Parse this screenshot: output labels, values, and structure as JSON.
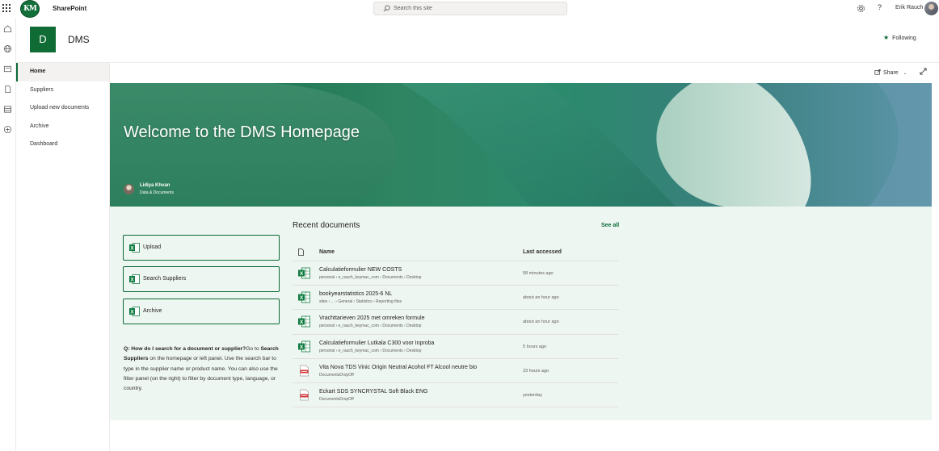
{
  "suite": {
    "app_name": "SharePoint",
    "logo_text": "KM",
    "search_placeholder": "Search this site",
    "help_label": "?",
    "user_name": "Erik Rauch"
  },
  "site": {
    "logo_letter": "D",
    "title": "DMS",
    "following_label": "Following"
  },
  "nav": {
    "items": [
      {
        "label": "Home"
      },
      {
        "label": "Suppliers"
      },
      {
        "label": "Upload new documents"
      },
      {
        "label": "Archive"
      },
      {
        "label": "Dashboard"
      }
    ]
  },
  "cmdbar": {
    "share_label": "Share"
  },
  "hero": {
    "title": "Welcome to the DMS Homepage",
    "author_name": "Lidiya Khvan",
    "author_dept": "Data & Documents"
  },
  "quicklinks": [
    {
      "label": "Upload"
    },
    {
      "label": "Search Suppliers"
    },
    {
      "label": "Archive"
    }
  ],
  "faq": {
    "question": "Q: How do I search for a document or supplier?",
    "text_1": "Go to ",
    "bold_1": "Search Suppliers",
    "text_2": " on the homepage or left panel. Use the search bar to type in the supplier name or product name. You can also use the filter panel (on the right) to filter by document type, language, or country."
  },
  "recent": {
    "title": "Recent documents",
    "see_all": "See all",
    "col_name": "Name",
    "col_accessed": "Last accessed",
    "rows": [
      {
        "name": "Calculatieformulier NEW COSTS",
        "path": "personal › e_rauch_keymac_com › Documents › Desktop",
        "time": "58 minutes ago",
        "type": "excel"
      },
      {
        "name": "bookyearstatistics 2025-6 NL",
        "path": "sites › ... › General › Statistics › Reporting files",
        "time": "about an hour ago",
        "type": "excel"
      },
      {
        "name": "Vrachttarieven 2025 met omreken formule",
        "path": "personal › e_rauch_keymac_com › Documents › Desktop",
        "time": "about an hour ago",
        "type": "excel"
      },
      {
        "name": "Calculatieformulier Lutkala C300 voor Inproba",
        "path": "personal › e_rauch_keymac_com › Documents › Desktop",
        "time": "5 hours ago",
        "type": "excel"
      },
      {
        "name": "Vita Nova TDS Vinic Origin Neutral Acohol FT Alcool neutre bio",
        "path": "DocumentsDropOff",
        "time": "23 hours ago",
        "type": "pdf"
      },
      {
        "name": "Eckart SDS SYNCRYSTAL Soft Black ENG",
        "path": "DocumentsDropOff",
        "time": "yesterday",
        "type": "pdf"
      }
    ]
  },
  "colors": {
    "brand_green": "#106c35",
    "accent_green": "#0b6a35",
    "section_bg": "#eef6f1"
  }
}
